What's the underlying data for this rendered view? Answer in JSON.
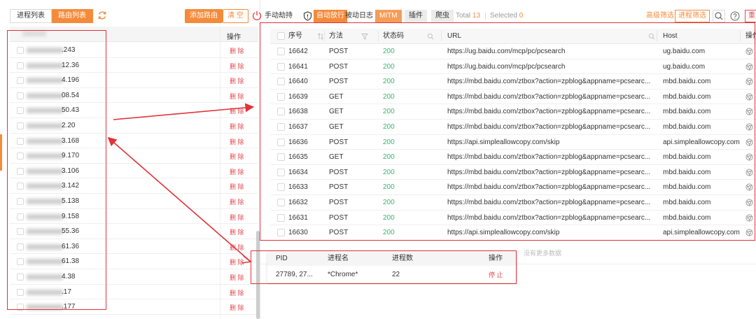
{
  "left": {
    "tabs": [
      {
        "label": "进程列表",
        "active": false
      },
      {
        "label": "路由列表",
        "active": true
      }
    ],
    "add_route": "添加路由",
    "clear": "清 空",
    "column_op": "操作",
    "delete_label": "删 除",
    "routes": [
      ".243",
      "12.36",
      "4.196",
      "08.54",
      "50.43",
      "2.20",
      "3.168",
      "9.170",
      "3.106",
      "3.142",
      "5.138",
      "9.158",
      "55.36",
      "61.36",
      "61.38",
      "4.38",
      ".17",
      ".177"
    ]
  },
  "toolbar": {
    "manual_hijack": "手动劫持",
    "auto_release": "自动放行",
    "passive_log": "被动日志",
    "mitm": "MITM",
    "plugin": "插件",
    "crawler": "爬虫",
    "total_label": "Total",
    "total_value": "13",
    "selected_label": "Selected",
    "selected_value": "0",
    "advanced_filter": "高级筛选",
    "process_filter": "进程筛选",
    "red_button": "重"
  },
  "requests": {
    "headers": {
      "id": "序号",
      "method": "方法",
      "status": "状态码",
      "url": "URL",
      "host": "Host",
      "op": "操作"
    },
    "rows": [
      {
        "id": "16642",
        "method": "POST",
        "status": "200",
        "url": "https://ug.baidu.com/mcp/pc/pcsearch",
        "host": "ug.baidu.com"
      },
      {
        "id": "16641",
        "method": "POST",
        "status": "200",
        "url": "https://ug.baidu.com/mcp/pc/pcsearch",
        "host": "ug.baidu.com"
      },
      {
        "id": "16640",
        "method": "POST",
        "status": "200",
        "url": "https://mbd.baidu.com/ztbox?action=zpblog&appname=pcsearc...",
        "host": "mbd.baidu.com"
      },
      {
        "id": "16639",
        "method": "GET",
        "status": "200",
        "url": "https://mbd.baidu.com/ztbox?action=zpblog&appname=pcsearc...",
        "host": "mbd.baidu.com"
      },
      {
        "id": "16638",
        "method": "GET",
        "status": "200",
        "url": "https://mbd.baidu.com/ztbox?action=zpblog&appname=pcsearc...",
        "host": "mbd.baidu.com"
      },
      {
        "id": "16637",
        "method": "GET",
        "status": "200",
        "url": "https://mbd.baidu.com/ztbox?action=zpblog&appname=pcsearc...",
        "host": "mbd.baidu.com"
      },
      {
        "id": "16636",
        "method": "POST",
        "status": "200",
        "url": "https://api.simpleallowcopy.com/skip",
        "host": "api.simpleallowcopy.com"
      },
      {
        "id": "16635",
        "method": "GET",
        "status": "200",
        "url": "https://mbd.baidu.com/ztbox?action=zpblog&appname=pcsearc...",
        "host": "mbd.baidu.com"
      },
      {
        "id": "16634",
        "method": "POST",
        "status": "200",
        "url": "https://mbd.baidu.com/ztbox?action=zpblog&appname=pcsearc...",
        "host": "mbd.baidu.com"
      },
      {
        "id": "16633",
        "method": "POST",
        "status": "200",
        "url": "https://mbd.baidu.com/ztbox?action=zpblog&appname=pcsearc...",
        "host": "mbd.baidu.com"
      },
      {
        "id": "16632",
        "method": "POST",
        "status": "200",
        "url": "https://mbd.baidu.com/ztbox?action=zpblog&appname=pcsearc...",
        "host": "mbd.baidu.com"
      },
      {
        "id": "16631",
        "method": "POST",
        "status": "200",
        "url": "https://mbd.baidu.com/ztbox?action=zpblog&appname=pcsearc...",
        "host": "mbd.baidu.com"
      },
      {
        "id": "16630",
        "method": "POST",
        "status": "200",
        "url": "https://api.simpleallowcopy.com/skip",
        "host": "api.simpleallowcopy.com"
      }
    ],
    "no_more": "没有更多数据"
  },
  "process": {
    "headers": {
      "pid": "PID",
      "name": "进程名",
      "count": "进程数",
      "op": "操作"
    },
    "row": {
      "pid": "27789, 27...",
      "name": "*Chrome*",
      "count": "22",
      "stop": "停 止"
    }
  },
  "colors": {
    "accent": "#f58b3a",
    "danger": "#e5484d",
    "success": "#3bb371",
    "annotation": "#e0333a"
  }
}
